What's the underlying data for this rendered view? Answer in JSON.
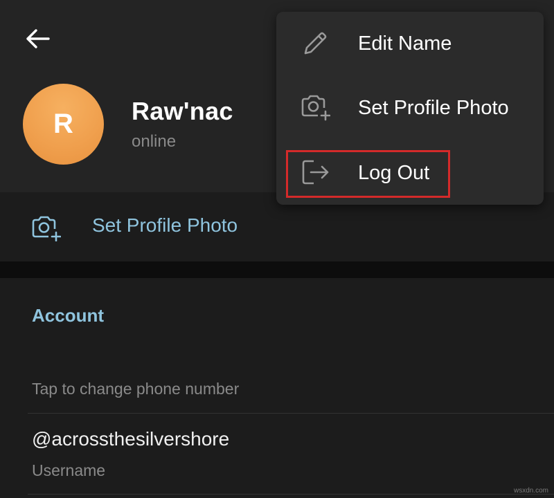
{
  "profile": {
    "avatar_letter": "R",
    "name": "Raw'nac",
    "status": "online"
  },
  "profile_actions": {
    "set_photo_label": "Set Profile Photo"
  },
  "account": {
    "section_title": "Account",
    "phone_hint": "Tap to change phone number",
    "username_value": "@acrossthesilvershore",
    "username_label": "Username"
  },
  "menu": {
    "items": [
      {
        "label": "Edit Name",
        "icon": "pencil-icon"
      },
      {
        "label": "Set Profile Photo",
        "icon": "camera-plus-icon"
      },
      {
        "label": "Log Out",
        "icon": "logout-icon"
      }
    ],
    "highlighted_item": "Log Out"
  },
  "watermark": "wsxdn.com",
  "colors": {
    "background": "#1c1c1c",
    "header_background": "#242424",
    "menu_background": "#2b2b2b",
    "accent_blue": "#8fc4de",
    "avatar_orange": "#f0a04e",
    "highlight_red": "#d42a2a",
    "secondary_text": "#8a8a8a"
  }
}
